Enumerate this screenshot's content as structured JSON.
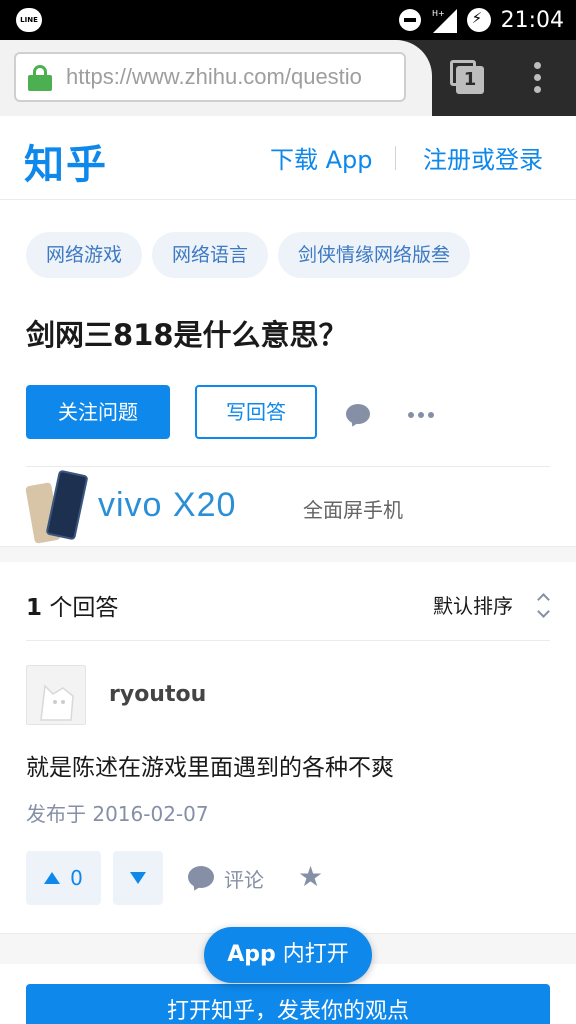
{
  "status_bar": {
    "app_icon": "LINE",
    "time": "21:04",
    "network": "H+",
    "icons": [
      "line-app-icon",
      "do-not-disturb-icon",
      "signal-icon",
      "battery-charging-icon"
    ]
  },
  "browser": {
    "url": "https://www.zhihu.com/questio",
    "tab_count": "1",
    "icons": [
      "lock-icon",
      "tabs-icon",
      "menu-icon"
    ]
  },
  "header": {
    "logo": "知乎",
    "download": "下载 App",
    "login": "注册或登录"
  },
  "question": {
    "topics": [
      "网络游戏",
      "网络语言",
      "剑侠情缘网络版叁"
    ],
    "title": "剑网三818是什么意思？",
    "follow_label": "关注问题",
    "answer_label": "写回答"
  },
  "ad": {
    "brand": "vivo X20",
    "tagline": "全面屏手机"
  },
  "answers": {
    "count": "1",
    "count_suffix": " 个回答",
    "sort_label": "默认排序",
    "items": [
      {
        "author": "ryoutou",
        "content": "就是陈述在游戏里面遇到的各种不爽",
        "date": "发布于 2016-02-07",
        "votes": "0",
        "comment_label": "评论"
      }
    ]
  },
  "footer": {
    "app_open_prefix": "App",
    "app_open_suffix": " 内打开",
    "open_button": "打开知乎，发表你的观点"
  },
  "colors": {
    "accent": "#0f88eb",
    "topic_bg": "#eef3fa",
    "muted": "#8590a6"
  }
}
